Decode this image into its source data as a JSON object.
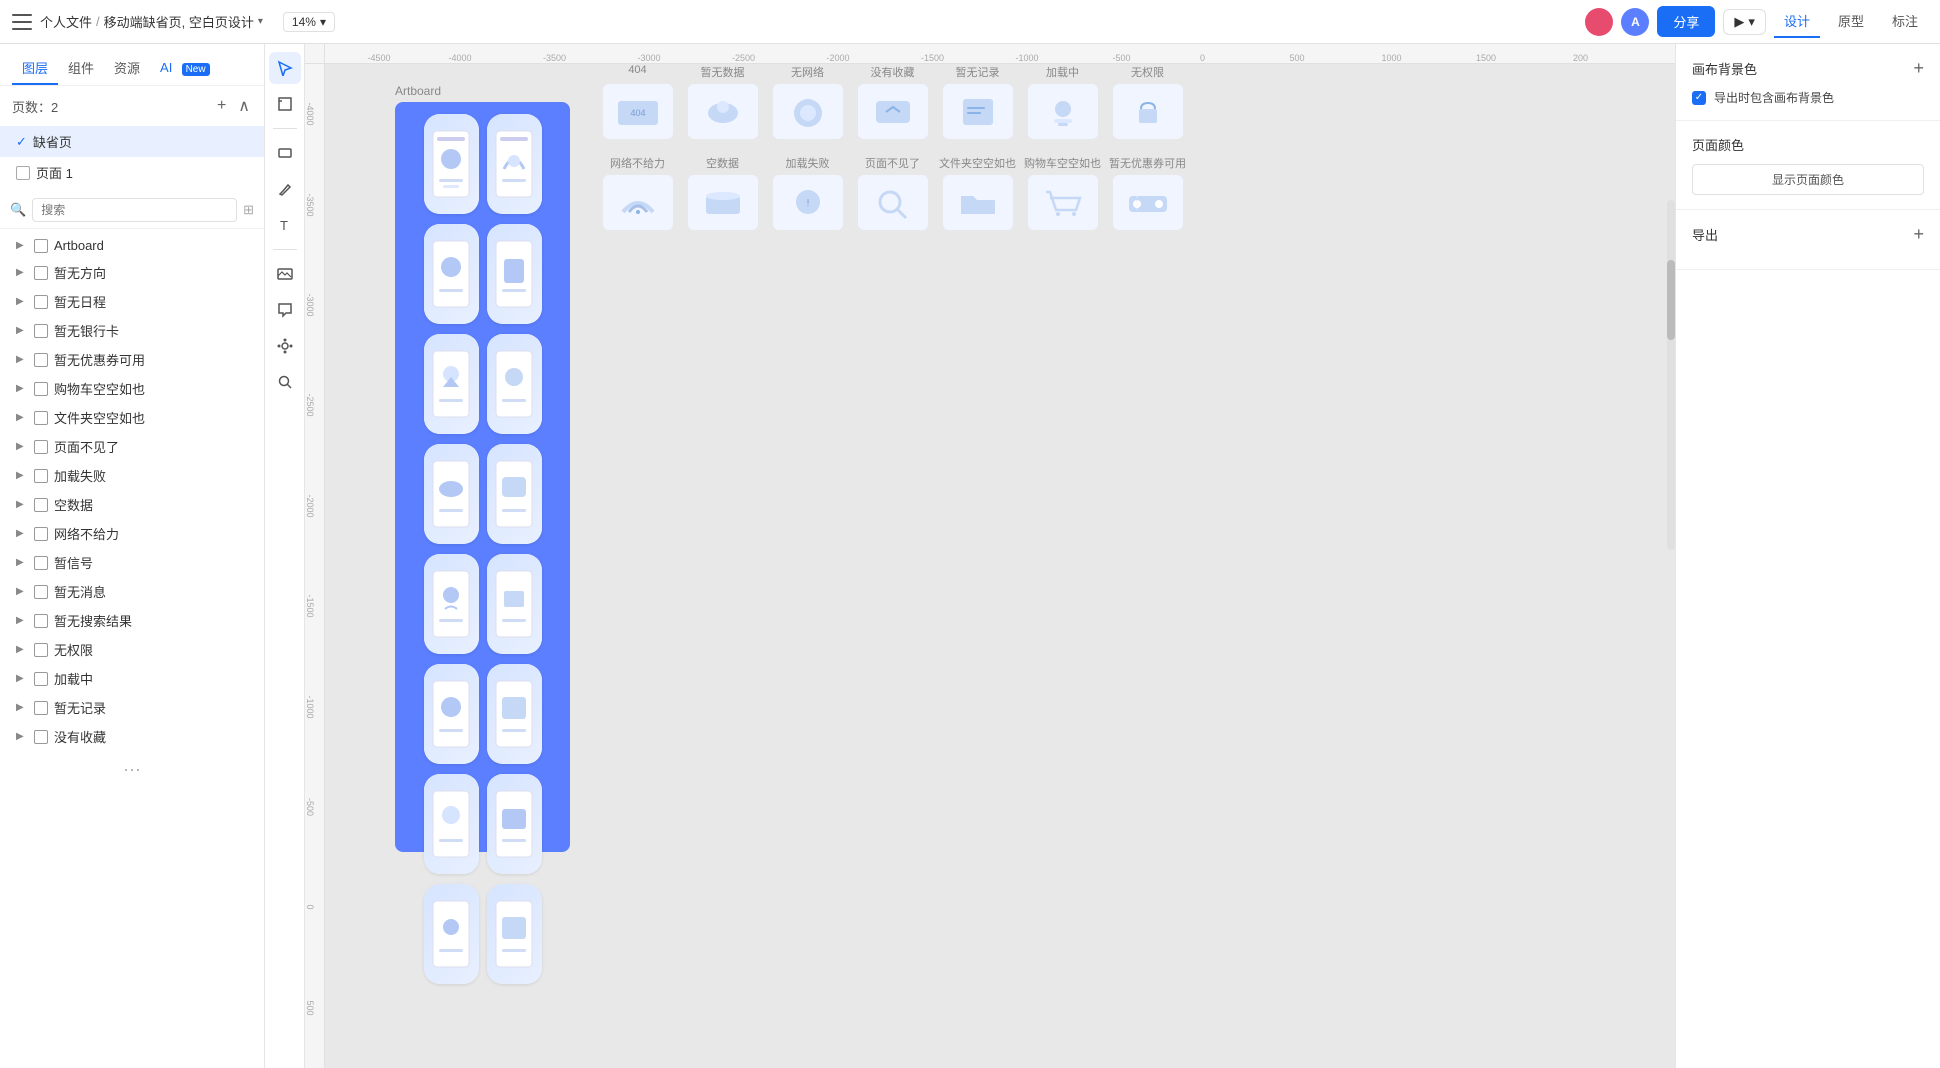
{
  "topbar": {
    "menu_icon": "menu",
    "breadcrumb": {
      "parent": "个人文件",
      "sep": "/",
      "current": "移动端缺省页, 空白页设计",
      "dropdown": "▾"
    },
    "zoom": "14%",
    "zoom_arrow": "▾",
    "avatar_text": "",
    "ai_icon_text": "A",
    "share_label": "分享",
    "play_label": "▶",
    "tabs": [
      {
        "label": "设计",
        "active": true
      },
      {
        "label": "原型",
        "active": false
      },
      {
        "label": "标注",
        "active": false
      }
    ]
  },
  "left_panel": {
    "tabs": [
      {
        "label": "图层",
        "active": true
      },
      {
        "label": "组件",
        "active": false
      },
      {
        "label": "资源",
        "active": false
      },
      {
        "label": "AI",
        "active": false
      },
      {
        "label": "New",
        "is_new": true
      }
    ],
    "pages_label": "页数：2",
    "add_page_title": "+",
    "collapse_title": "∧",
    "pages": [
      {
        "label": "缺省页",
        "checked": true
      },
      {
        "label": "页面 1",
        "checked": false
      }
    ],
    "search_placeholder": "搜索",
    "layers": [
      {
        "label": "Artboard",
        "indent": 0
      },
      {
        "label": "暂无方向",
        "indent": 0
      },
      {
        "label": "暂无日程",
        "indent": 0
      },
      {
        "label": "暂无银行卡",
        "indent": 0
      },
      {
        "label": "暂无优惠券可用",
        "indent": 0
      },
      {
        "label": "购物车空空如也",
        "indent": 0
      },
      {
        "label": "文件夹空空如也",
        "indent": 0
      },
      {
        "label": "页面不见了",
        "indent": 0
      },
      {
        "label": "加载失败",
        "indent": 0
      },
      {
        "label": "空数据",
        "indent": 0
      },
      {
        "label": "网络不给力",
        "indent": 0
      },
      {
        "label": "暂信号",
        "indent": 0
      },
      {
        "label": "暂无消息",
        "indent": 0
      },
      {
        "label": "暂无搜索结果",
        "indent": 0
      },
      {
        "label": "无权限",
        "indent": 0
      },
      {
        "label": "加载中",
        "indent": 0
      },
      {
        "label": "暂无记录",
        "indent": 0
      },
      {
        "label": "没有收藏",
        "indent": 0
      }
    ]
  },
  "canvas": {
    "ruler_ticks_h": [
      "-4500",
      "-4000",
      "-3500",
      "-3000",
      "-2500",
      "-2000",
      "-1500",
      "-1000",
      "-500",
      "0",
      "500",
      "1000",
      "1500",
      "200"
    ],
    "ruler_ticks_v": [
      "-4000",
      "-3500",
      "-3000",
      "-2500",
      "-2000",
      "-1500",
      "-1000",
      "-500",
      "0",
      "500"
    ],
    "artboard_label": "Artboard",
    "card_rows": [
      {
        "row": 1,
        "cards": [
          {
            "label": "404",
            "color": "#d0dcf5"
          },
          {
            "label": "暂无数据",
            "color": "#d0dcf5"
          },
          {
            "label": "无网络",
            "color": "#d0dcf5"
          },
          {
            "label": "没有收藏",
            "color": "#d0dcf5"
          },
          {
            "label": "暂无记录",
            "color": "#d0dcf5"
          },
          {
            "label": "加载中",
            "color": "#d0dcf5"
          },
          {
            "label": "无权限",
            "color": "#d0dcf5"
          }
        ]
      },
      {
        "row": 2,
        "cards": [
          {
            "label": "网络不给力",
            "color": "#d0dcf5"
          },
          {
            "label": "空数据",
            "color": "#d0dcf5"
          },
          {
            "label": "加载失败",
            "color": "#d0dcf5"
          },
          {
            "label": "页面不见了",
            "color": "#d0dcf5"
          },
          {
            "label": "文件夹空空如也",
            "color": "#d0dcf5"
          },
          {
            "label": "购物车空空如也",
            "color": "#d0dcf5"
          },
          {
            "label": "暂无优惠券可用",
            "color": "#d0dcf5"
          }
        ]
      }
    ]
  },
  "right_panel": {
    "canvas_bg_title": "画布背景色",
    "canvas_bg_add": "+",
    "export_bg_checkbox": "导出时包含画布背景色",
    "page_color_title": "页面颜色",
    "page_color_btn": "显示页面颜色",
    "export_title": "导出",
    "export_add": "+"
  }
}
